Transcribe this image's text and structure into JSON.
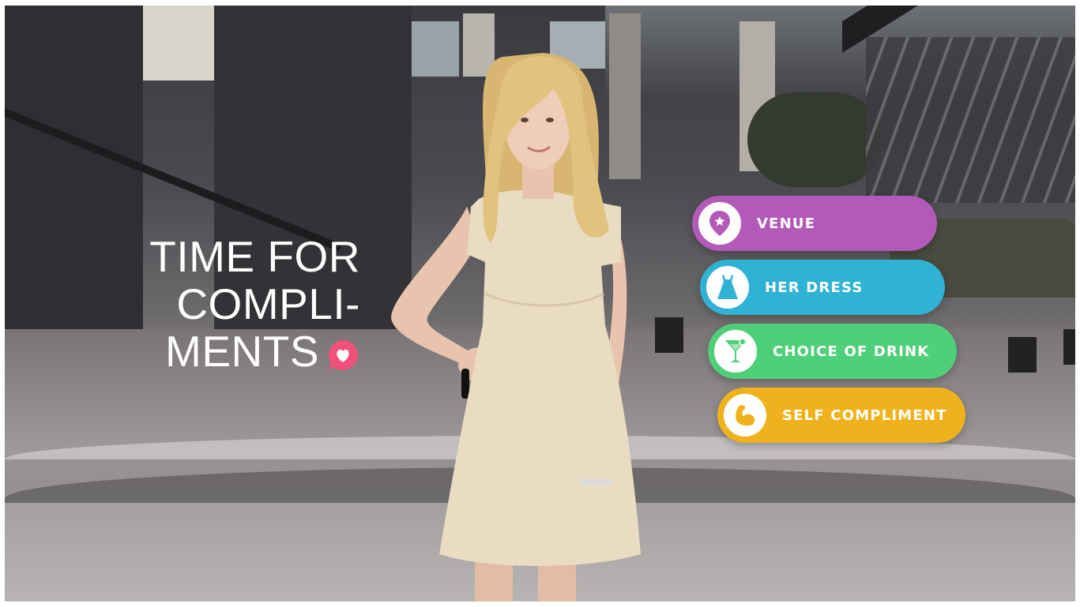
{
  "title": {
    "line1": "TIME FOR",
    "line2": "COMPLI-",
    "line3": "MENTS",
    "icon": "heart-speech-bubble-icon",
    "icon_color": "#f0507a"
  },
  "options": [
    {
      "label": "VENUE",
      "icon": "location-pin-icon",
      "color": "#b25ab8"
    },
    {
      "label": "HER DRESS",
      "icon": "dress-icon",
      "color": "#2fb2d3"
    },
    {
      "label": "CHOICE OF DRINK",
      "icon": "cocktail-glass-icon",
      "color": "#4fcf79"
    },
    {
      "label": "SELF COMPLIMENT",
      "icon": "flexed-bicep-icon",
      "color": "#f0b21c"
    }
  ]
}
